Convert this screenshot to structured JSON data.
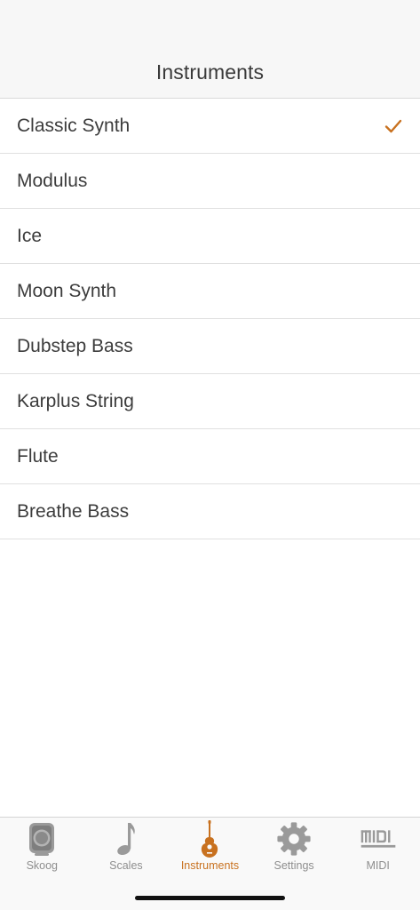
{
  "nav": {
    "title": "Instruments"
  },
  "instruments": {
    "items": [
      {
        "label": "Classic Synth",
        "selected": true
      },
      {
        "label": "Modulus",
        "selected": false
      },
      {
        "label": "Ice",
        "selected": false
      },
      {
        "label": "Moon Synth",
        "selected": false
      },
      {
        "label": "Dubstep Bass",
        "selected": false
      },
      {
        "label": "Karplus String",
        "selected": false
      },
      {
        "label": "Flute",
        "selected": false
      },
      {
        "label": "Breathe Bass",
        "selected": false
      }
    ]
  },
  "tabbar": {
    "tabs": [
      {
        "label": "Skoog",
        "icon": "skoog-device-icon",
        "active": false
      },
      {
        "label": "Scales",
        "icon": "music-note-icon",
        "active": false
      },
      {
        "label": "Instruments",
        "icon": "guitar-icon",
        "active": true
      },
      {
        "label": "Settings",
        "icon": "gear-icon",
        "active": false
      },
      {
        "label": "MIDI",
        "icon": "midi-icon",
        "active": false
      }
    ]
  },
  "colors": {
    "accent": "#c8711f",
    "inactive": "#8e8e8e",
    "text": "#3c3c3c",
    "separator": "#e0e0e0",
    "navbar_bg": "#f7f7f7"
  }
}
